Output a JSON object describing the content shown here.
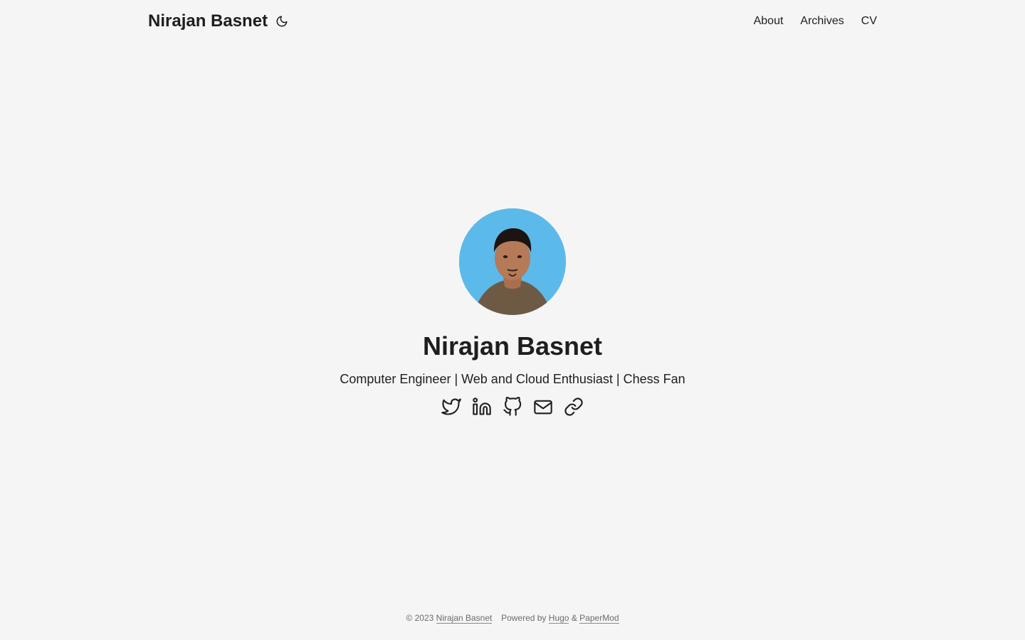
{
  "header": {
    "logo": "Nirajan Basnet",
    "theme_icon": "moon-icon",
    "nav": [
      {
        "label": "About"
      },
      {
        "label": "Archives"
      },
      {
        "label": "CV"
      }
    ]
  },
  "profile": {
    "name": "Nirajan Basnet",
    "subtitle": "Computer Engineer | Web and Cloud Enthusiast | Chess Fan",
    "avatar_bg": "#5cbaeb",
    "socials": [
      {
        "icon": "twitter-icon"
      },
      {
        "icon": "linkedin-icon"
      },
      {
        "icon": "github-icon"
      },
      {
        "icon": "email-icon"
      },
      {
        "icon": "link-icon"
      }
    ]
  },
  "footer": {
    "copyright": "© 2023",
    "author": "Nirajan Basnet",
    "powered_by": "Powered by",
    "hugo": "Hugo",
    "amp": "&",
    "theme": "PaperMod"
  }
}
